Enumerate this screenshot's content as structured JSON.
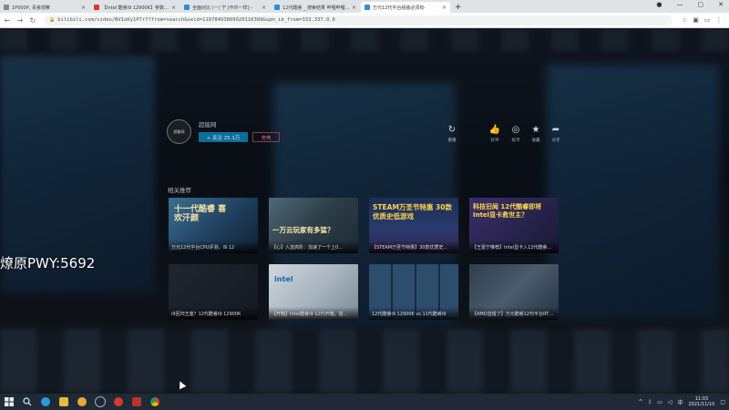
{
  "browser": {
    "tabs": [
      {
        "title": "1P000P, 青瓷观察",
        "favicon_color": "#888888",
        "active": false
      },
      {
        "title": "【Intel 酷睿i9 12900K】参数_报",
        "favicon_color": "#d93a2b",
        "active": false
      },
      {
        "title": "全面对比 (一) 宁 [不许一样] -",
        "favicon_color": "#2a8fd8",
        "active": false
      },
      {
        "title": "12代酷睿 _ 搜索结果 哔哩哔哩 - 哔",
        "favicon_color": "#2a8fd8",
        "active": false
      },
      {
        "title": "万元12代平台组装必须有-",
        "favicon_color": "#2a8fd8",
        "active": true
      }
    ],
    "new_tab_label": "+",
    "url": "bilibili.com/video/BV1oKy1P7r7?from=search&seid=11078493809920116389&spm_id_from=333.337.0.0"
  },
  "uploader": {
    "avatar_text": "超能网",
    "name": "超能网",
    "follow_label": "+ 关注 25.1万",
    "charge_label": "充电"
  },
  "actions": [
    {
      "icon": "replay-icon",
      "label": "重播"
    },
    {
      "icon": "like-icon",
      "label": "好评"
    },
    {
      "icon": "coin-icon",
      "label": "投币"
    },
    {
      "icon": "favorite-icon",
      "label": "收藏"
    },
    {
      "icon": "share-icon",
      "label": "分享"
    }
  ],
  "related": {
    "title": "相关推荐",
    "cards": [
      {
        "caption": "万元12代平台CPU评测，i9 12",
        "overlay": "十一代酷睿 喜欢汗颜"
      },
      {
        "caption": "【心】入选高阶：加速了一个上0...",
        "overlay": "一万云玩家有多猛？"
      },
      {
        "caption": "【STEAM万圣节特惠】30款优质史...",
        "overlay": "STEAM万圣节特惠 30款优质史低游戏"
      },
      {
        "caption": "【王嘉宁推荐】Intel显卡入12代酷睿...",
        "overlay": "科技旧闻 12代酷睿即将 Intel显卡救世主？"
      },
      {
        "caption": "i9回归王座？12代酷睿i9 12900K",
        "overlay": ""
      },
      {
        "caption": "【开箱】Intel酷睿i9 12代开箱，首...",
        "overlay": "intel"
      },
      {
        "caption": "12代酷睿i9 12900K vs 11代酷睿i9",
        "overlay": ""
      },
      {
        "caption": "【AMD选错了】万元酷睿12代平台RTX 3...",
        "overlay": ""
      }
    ]
  },
  "watermark": "燎原PWY:5692",
  "taskbar": {
    "apps": [
      "windows-start",
      "search",
      "edge",
      "explorer",
      "fox-app",
      "steam",
      "netease-music",
      "bilibili",
      "chrome"
    ],
    "time": "11:03",
    "date": "2021/11/10",
    "ime": "中"
  },
  "colors": {
    "follow": "#0d6e99",
    "charge": "#8a3d4a",
    "taskbar": "#1f2a37"
  }
}
